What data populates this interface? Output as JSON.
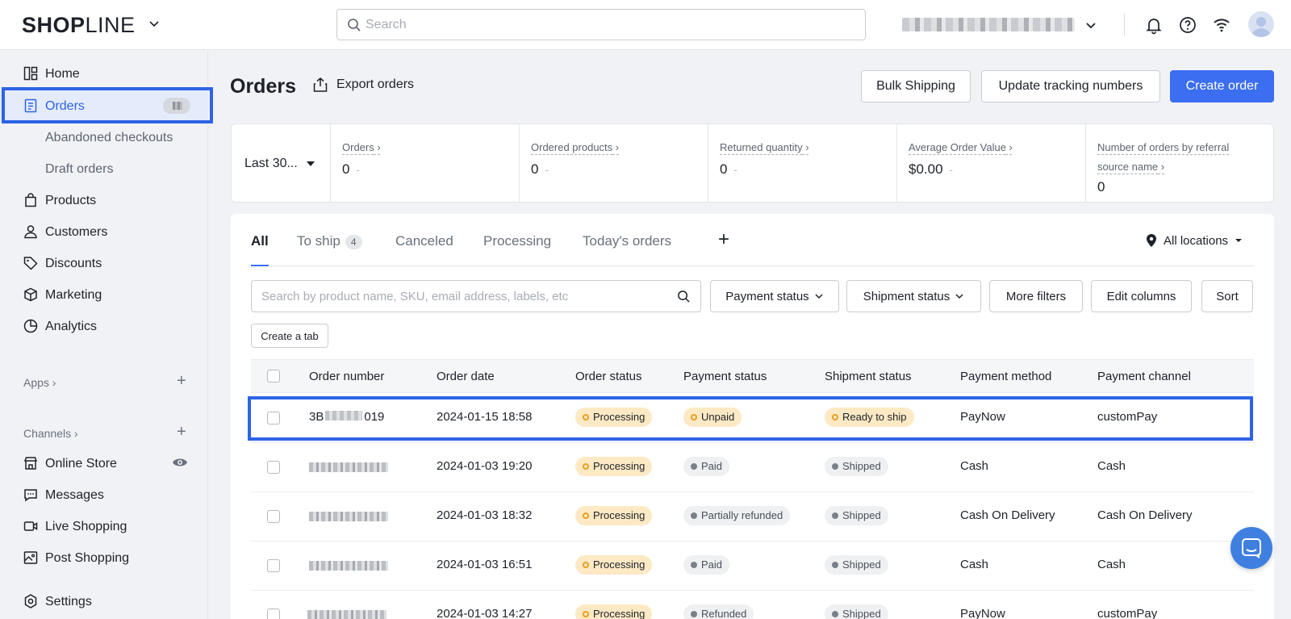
{
  "brand": {
    "name_bold": "SHOP",
    "name_thin": "LINE",
    "accent": "#3b6ef0"
  },
  "search": {
    "placeholder": "Search"
  },
  "sidebar": {
    "items": [
      {
        "label": "Home",
        "icon": "home-icon"
      },
      {
        "label": "Orders",
        "icon": "orders-icon",
        "active": true
      },
      {
        "label": "Abandoned checkouts",
        "sub": true
      },
      {
        "label": "Draft orders",
        "sub": true
      },
      {
        "label": "Products",
        "icon": "bag-icon"
      },
      {
        "label": "Customers",
        "icon": "person-icon"
      },
      {
        "label": "Discounts",
        "icon": "tag-icon"
      },
      {
        "label": "Marketing",
        "icon": "cube-icon"
      },
      {
        "label": "Analytics",
        "icon": "pie-chart-icon"
      }
    ],
    "apps_label": "Apps",
    "channels_label": "Channels",
    "channels": [
      {
        "label": "Online Store",
        "icon": "store-icon"
      },
      {
        "label": "Messages",
        "icon": "chat-icon"
      },
      {
        "label": "Live Shopping",
        "icon": "video-icon"
      },
      {
        "label": "Post Shopping",
        "icon": "image-icon"
      }
    ],
    "settings_label": "Settings"
  },
  "header": {
    "title": "Orders",
    "export_label": "Export orders",
    "bulk_shipping": "Bulk Shipping",
    "update_tracking": "Update tracking numbers",
    "create_order": "Create order"
  },
  "stats": {
    "range": "Last 30...",
    "cards": [
      {
        "label": "Orders",
        "value": "0",
        "dash": "-"
      },
      {
        "label": "Ordered products",
        "value": "0",
        "dash": "-"
      },
      {
        "label": "Returned quantity",
        "value": "0",
        "dash": "-"
      },
      {
        "label": "Average Order Value",
        "value": "$0.00",
        "dash": "-"
      },
      {
        "label_line1": "Number of orders by referral",
        "label_line2": "source name",
        "value": "0"
      }
    ]
  },
  "tabs": {
    "all": "All",
    "to_ship": "To ship",
    "to_ship_count": "4",
    "canceled": "Canceled",
    "processing": "Processing",
    "today": "Today's orders",
    "add": "+",
    "locations": "All locations"
  },
  "filters": {
    "search_placeholder": "Search by product name, SKU, email address, labels, etc",
    "payment_status": "Payment status",
    "shipment_status": "Shipment status",
    "more_filters": "More filters",
    "edit_columns": "Edit columns",
    "sort": "Sort",
    "create_tab": "Create a tab"
  },
  "table": {
    "columns": [
      "Order number",
      "Order date",
      "Order status",
      "Payment status",
      "Shipment status",
      "Payment method",
      "Payment channel"
    ],
    "rows": [
      {
        "order_prefix": "3B",
        "order_suffix": "019",
        "date": "2024-01-15 18:58",
        "status": "Processing",
        "payment": "Unpaid",
        "payment_style": "warn",
        "shipment": "Ready to ship",
        "shipment_style": "warn",
        "method": "PayNow",
        "channel": "customPay"
      },
      {
        "date": "2024-01-03 19:20",
        "status": "Processing",
        "payment": "Paid",
        "payment_style": "gray",
        "shipment": "Shipped",
        "shipment_style": "gray",
        "method": "Cash",
        "channel": "Cash"
      },
      {
        "date": "2024-01-03 18:32",
        "status": "Processing",
        "payment": "Partially refunded",
        "payment_style": "gray",
        "shipment": "Shipped",
        "shipment_style": "gray",
        "method": "Cash On Delivery",
        "channel": "Cash On Delivery"
      },
      {
        "date": "2024-01-03 16:51",
        "status": "Processing",
        "payment": "Paid",
        "payment_style": "gray",
        "shipment": "Shipped",
        "shipment_style": "gray",
        "method": "Cash",
        "channel": "Cash"
      },
      {
        "date": "2024-01-03 14:27",
        "status": "Processing",
        "payment": "Refunded",
        "payment_style": "gray",
        "shipment": "Shipped",
        "shipment_style": "gray",
        "method": "PayNow",
        "channel": "customPay"
      }
    ]
  }
}
